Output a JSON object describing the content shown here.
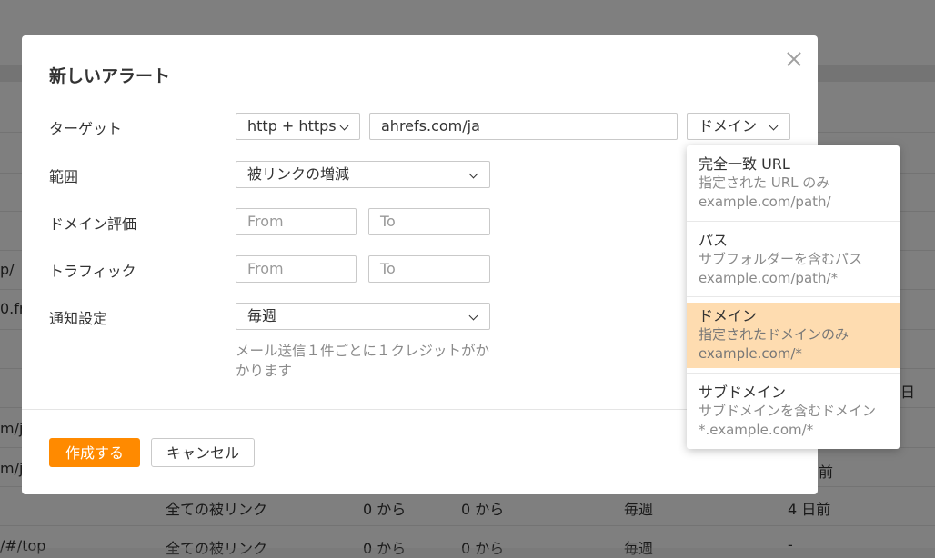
{
  "background_table": {
    "fragments": {
      "r1": "p/",
      "r2": "0.fr",
      "r3a": "m/j",
      "r3b": "m/j",
      "r4": "/#/top",
      "r3_right": "日"
    },
    "rows": [
      {
        "type": "全ての被リンク",
        "from": "0 から",
        "to": "0 から",
        "freq": "毎週",
        "date": "4 日前"
      },
      {
        "type": "全ての被リンク",
        "from": "0 から",
        "to": "0 から",
        "freq": "毎週",
        "date": "-"
      }
    ],
    "row0_date": "前"
  },
  "modal": {
    "title": "新しいアラート",
    "target": {
      "label": "ターゲット",
      "protocol": "http + https",
      "url": "ahrefs.com/ja",
      "mode": "ドメイン"
    },
    "scope": {
      "label": "範囲",
      "value": "被リンクの増減"
    },
    "dr": {
      "label": "ドメイン評価",
      "from_placeholder": "From",
      "to_placeholder": "To"
    },
    "traffic": {
      "label": "トラフィック",
      "from_placeholder": "From",
      "to_placeholder": "To"
    },
    "notify": {
      "label": "通知設定",
      "value": "毎週",
      "note": "メール送信１件ごとに１クレジットがかかります"
    },
    "create_label": "作成する",
    "cancel_label": "キャンセル"
  },
  "mode_menu": {
    "items": [
      {
        "title": "完全一致 URL",
        "desc": "指定された URL のみ",
        "example": "example.com/path/"
      },
      {
        "title": "パス",
        "desc": "サブフォルダーを含むパス",
        "example": "example.com/path/*"
      },
      {
        "title": "ドメイン",
        "desc": "指定されたドメインのみ",
        "example": "example.com/*"
      },
      {
        "title": "サブドメイン",
        "desc": "サブドメインを含むドメイン",
        "example": "*.example.com/*"
      }
    ],
    "selected_index": 2
  },
  "colors": {
    "primary": "#ff8a00",
    "selected_bg": "#fedcb0",
    "overlay": "rgba(0,0,0,0.5)"
  },
  "icons": {
    "close": "close-icon",
    "chevron": "chevron-down-icon"
  }
}
